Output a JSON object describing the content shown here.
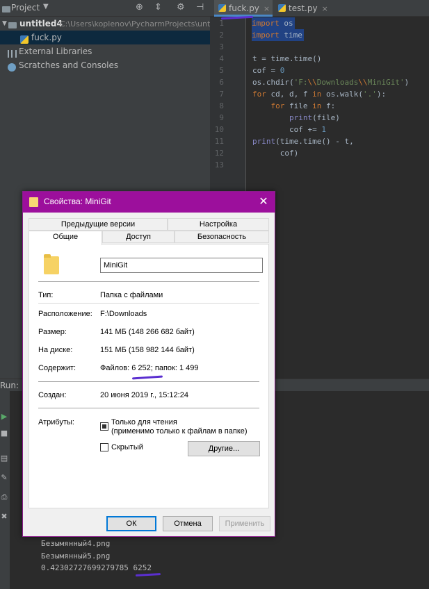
{
  "project_panel": {
    "title": "Project",
    "tree": [
      {
        "label": "untitled4",
        "path": "C:\\Users\\koplenov\\PycharmProjects\\untit"
      },
      {
        "label": "fuck.py"
      },
      {
        "label": "External Libraries"
      },
      {
        "label": "Scratches and Consoles"
      }
    ]
  },
  "editor": {
    "tabs": [
      {
        "label": "fuck.py",
        "active": true
      },
      {
        "label": "test.py",
        "active": false
      }
    ],
    "line_numbers": [
      "1",
      "2",
      "3",
      "4",
      "5",
      "6",
      "7",
      "8",
      "9",
      "10",
      "11",
      "12",
      "13"
    ]
  },
  "run_panel": {
    "label": "Run:",
    "output": [
      "Безымянный4.png",
      "Безымянный5.png",
      "0.42302727699279785 6252"
    ]
  },
  "dialog": {
    "title": "Свойства: MiniGit",
    "tabs_row1": [
      "Предыдущие версии",
      "Настройка"
    ],
    "tabs_row2": [
      "Общие",
      "Доступ",
      "Безопасность"
    ],
    "folder_name": "MiniGit",
    "props": {
      "type_label": "Тип:",
      "type_value": "Папка с файлами",
      "location_label": "Расположение:",
      "location_value": "F:\\Downloads",
      "size_label": "Размер:",
      "size_value": "141 МБ (148 266 682 байт)",
      "disk_label": "На диске:",
      "disk_value": "151 МБ (158 982 144 байт)",
      "contains_label": "Содержит:",
      "contains_value": "Файлов: 6 252; папок: 1 499",
      "created_label": "Создан:",
      "created_value": "20 июня 2019 г., 15:12:24",
      "attributes_label": "Атрибуты:",
      "readonly_label": "Только для чтения",
      "readonly_note": "(применимо только к файлам в папке)",
      "hidden_label": "Скрытый",
      "other_button": "Другие..."
    },
    "buttons": {
      "ok": "ОК",
      "cancel": "Отмена",
      "apply": "Применить"
    }
  },
  "colors": {
    "ide_bg": "#2b2b2b",
    "dialog_accent": "#9c0f9c",
    "annotation": "#5b2fd0"
  }
}
